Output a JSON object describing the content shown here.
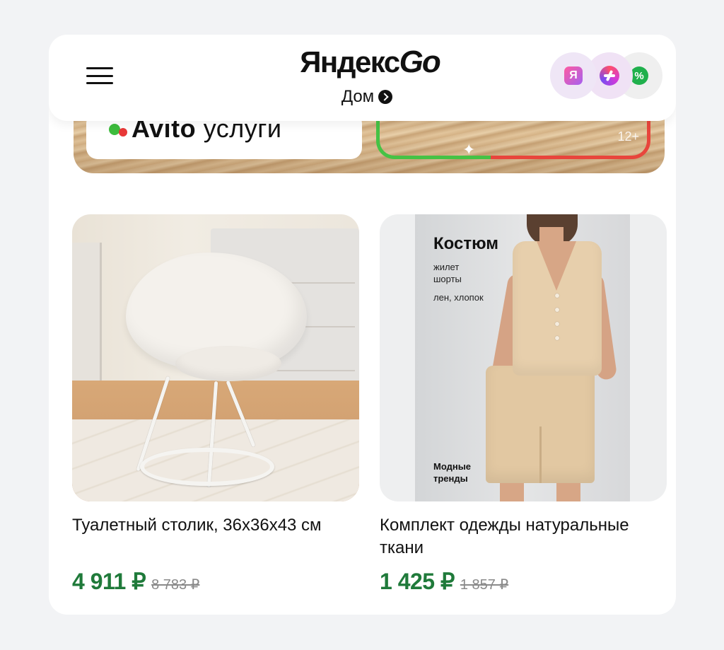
{
  "header": {
    "brand_main": "Яндекс",
    "brand_go": "Go",
    "subtitle": "Дом",
    "badges": {
      "ya": "Я",
      "pct": "%"
    }
  },
  "banner": {
    "brand_bold": "Avito",
    "brand_light": "услуги",
    "age": "12+"
  },
  "products": [
    {
      "title": "Туалетный столик, 36х36х43 см",
      "price_now": "4 911 ₽",
      "price_old": "8 783 ₽"
    },
    {
      "title": "Комплект одежды натуральные ткани",
      "price_now": "1 425 ₽",
      "price_old": "1 857 ₽",
      "image_text": {
        "title": "Костюм",
        "line1": "жилет",
        "line2": "шорты",
        "line3": "лен, хлопок",
        "foot1": "Модные",
        "foot2": "тренды"
      }
    }
  ],
  "colors": {
    "price_green": "#1f7a3a",
    "avito_green": "#3dbc3d",
    "avito_red": "#e83838"
  }
}
